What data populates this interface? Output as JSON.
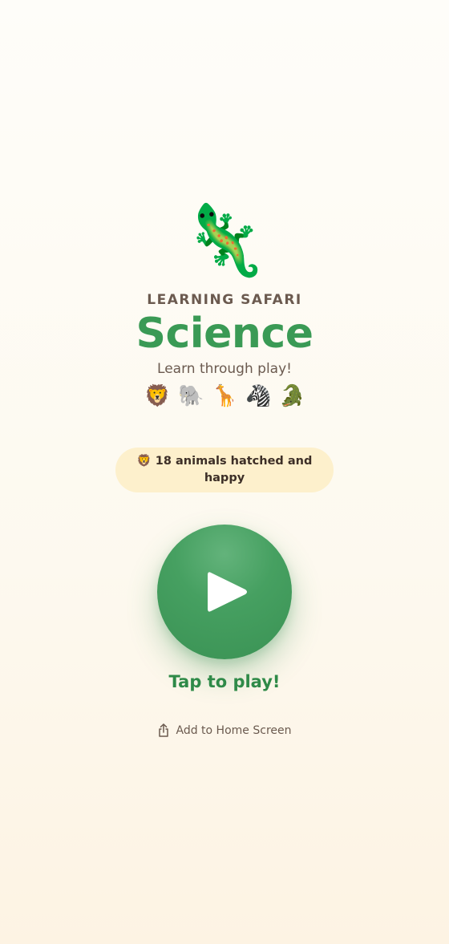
{
  "hero": {
    "emoji": "🦎"
  },
  "eyebrow": "LEARNING SAFARI",
  "title": "Science",
  "tagline": "Learn through play!",
  "animals": [
    "🦁",
    "🐘",
    "🦒",
    "🦓",
    "🐊"
  ],
  "status": {
    "emoji": "🦁",
    "text": "18 animals hatched and happy"
  },
  "play": {
    "icon": "play-icon",
    "caption": "Tap to play!"
  },
  "add_home": {
    "icon": "share-icon",
    "label": "Add to Home Screen"
  },
  "colors": {
    "accent": "#3a9a55",
    "text_muted": "#6b5a4f",
    "pill_bg": "#fdf0cc"
  }
}
